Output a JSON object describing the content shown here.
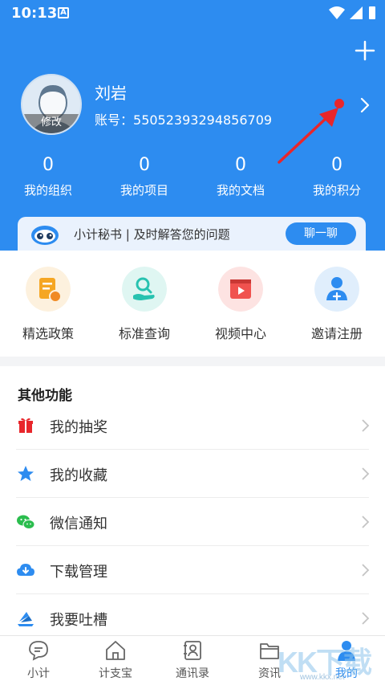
{
  "status_bar": {
    "time": "10:13",
    "notification_badge": "A"
  },
  "profile": {
    "name": "刘岩",
    "account_label": "账号：",
    "account_number": "55052393294856709",
    "avatar_edit": "修改"
  },
  "stats": [
    {
      "value": "0",
      "label": "我的组织"
    },
    {
      "value": "0",
      "label": "我的项目"
    },
    {
      "value": "0",
      "label": "我的文档"
    },
    {
      "value": "0",
      "label": "我的积分"
    }
  ],
  "secretary": {
    "text": "小计秘书 | 及时解答您的问题",
    "button": "聊一聊"
  },
  "quick_actions": [
    {
      "label": "精选政策",
      "icon": "policy-icon",
      "color": "#f5a623"
    },
    {
      "label": "标准查询",
      "icon": "standard-search-icon",
      "color": "#27c2b0"
    },
    {
      "label": "视频中心",
      "icon": "video-icon",
      "color": "#f0524f"
    },
    {
      "label": "邀请注册",
      "icon": "invite-user-icon",
      "color": "#2d8cf0"
    }
  ],
  "other_functions": {
    "title": "其他功能",
    "items": [
      {
        "label": "我的抽奖",
        "icon": "gift-icon",
        "color": "#e8262b"
      },
      {
        "label": "我的收藏",
        "icon": "star-icon",
        "color": "#2d8cf0"
      },
      {
        "label": "微信通知",
        "icon": "wechat-icon",
        "color": "#2bbd4e"
      },
      {
        "label": "下载管理",
        "icon": "cloud-download-icon",
        "color": "#2d8cf0"
      },
      {
        "label": "我要吐槽",
        "icon": "feedback-icon",
        "color": "#2d8cf0"
      }
    ]
  },
  "tabbar": [
    {
      "label": "小计",
      "icon": "chat-icon"
    },
    {
      "label": "计支宝",
      "icon": "home-icon"
    },
    {
      "label": "通讯录",
      "icon": "contacts-icon"
    },
    {
      "label": "资讯",
      "icon": "news-icon"
    },
    {
      "label": "我的",
      "icon": "profile-icon",
      "active": true
    }
  ],
  "watermark": {
    "text": "KK下载",
    "url": "www.kkx.net"
  },
  "colors": {
    "primary": "#2d8cf0",
    "alert": "#e8262b"
  }
}
